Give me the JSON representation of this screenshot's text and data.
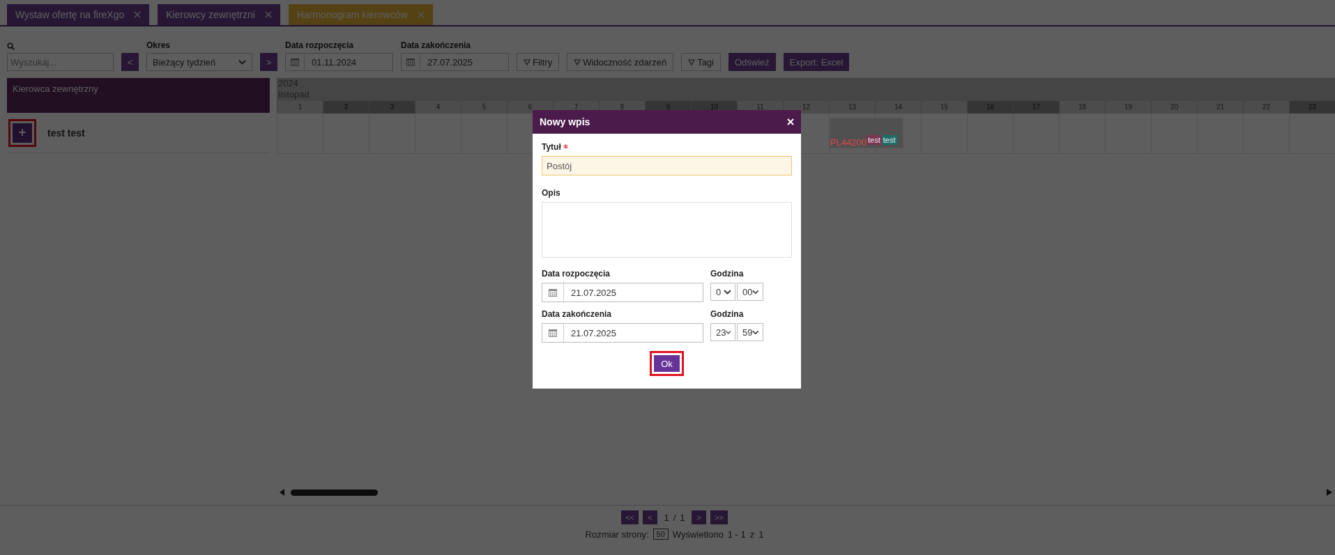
{
  "tabs": [
    {
      "label": "Wystaw ofertę na fireXgo",
      "selected": false
    },
    {
      "label": "Kierowcy zewnętrzni",
      "selected": false
    },
    {
      "label": "Harmonogram kierowców",
      "selected": true
    }
  ],
  "toolbar": {
    "search_placeholder": "Wyszukaj...",
    "prev_button": "<",
    "period_label": "Okres",
    "period_value": "Bieżący tydzień",
    "next_button": ">",
    "start_label": "Data rozpoczęcia",
    "start_value": "01.11.2024",
    "end_label": "Data zakończenia",
    "end_value": "27.07.2025",
    "buttons": [
      {
        "label": "Filtry",
        "kind": "filter"
      },
      {
        "label": "Widoczność zdarzeń",
        "kind": "filter"
      },
      {
        "label": "Tagi",
        "kind": "filter"
      },
      {
        "label": "Odśwież",
        "kind": "action"
      },
      {
        "label": "Export: Excel",
        "kind": "action"
      }
    ]
  },
  "schedule": {
    "resource_header": "Kierowca zewnętrzny",
    "year": "2024",
    "month": "listopad",
    "days": [
      {
        "label": "1",
        "weekend": false
      },
      {
        "label": "2",
        "weekend": true
      },
      {
        "label": "3",
        "weekend": true
      },
      {
        "label": "4",
        "weekend": false
      },
      {
        "label": "5",
        "weekend": false
      },
      {
        "label": "6",
        "weekend": false
      },
      {
        "label": "7",
        "weekend": false
      },
      {
        "label": "8",
        "weekend": false
      },
      {
        "label": "9",
        "weekend": true
      },
      {
        "label": "10",
        "weekend": true
      },
      {
        "label": "11",
        "weekend": false
      },
      {
        "label": "12",
        "weekend": false
      },
      {
        "label": "13",
        "weekend": false
      },
      {
        "label": "14",
        "weekend": false
      },
      {
        "label": "15",
        "weekend": false
      },
      {
        "label": "16",
        "weekend": true
      },
      {
        "label": "17",
        "weekend": true
      },
      {
        "label": "18",
        "weekend": false
      },
      {
        "label": "19",
        "weekend": false
      },
      {
        "label": "20",
        "weekend": false
      },
      {
        "label": "21",
        "weekend": false
      },
      {
        "label": "22",
        "weekend": false
      },
      {
        "label": "23",
        "weekend": true
      }
    ],
    "rows": [
      {
        "add_button": "+",
        "highlighted": true,
        "name": "test test",
        "events": [
          {
            "code": "PL44200",
            "tags": [
              {
                "label": "test",
                "color": "#7a3553"
              },
              {
                "label": "test",
                "color": "#1e6e68"
              }
            ]
          }
        ]
      }
    ]
  },
  "pagination": {
    "first": "<<",
    "prev": "<",
    "page": "1",
    "separator": "/",
    "total": "1",
    "next": ">",
    "last": ">>",
    "page_size_label": "Rozmiar strony:",
    "page_size": "50",
    "shown_label": "Wyświetlono",
    "range": "1 - 1",
    "of": "z",
    "count": "1"
  },
  "dialog": {
    "title": "Nowy wpis",
    "title_label": "Tytuł",
    "title_required": true,
    "title_value": "Postój",
    "description_label": "Opis",
    "ranges": [
      {
        "date_label": "Data rozpoczęcia",
        "date": "21.07.2025",
        "hour_label": "Godzina",
        "hour": "0",
        "minute": "00"
      },
      {
        "date_label": "Data zakończenia",
        "date": "21.07.2025",
        "hour_label": "Godzina",
        "hour": "23",
        "minute": "59"
      }
    ],
    "ok_button": {
      "label": "Ok",
      "highlighted": true
    }
  }
}
